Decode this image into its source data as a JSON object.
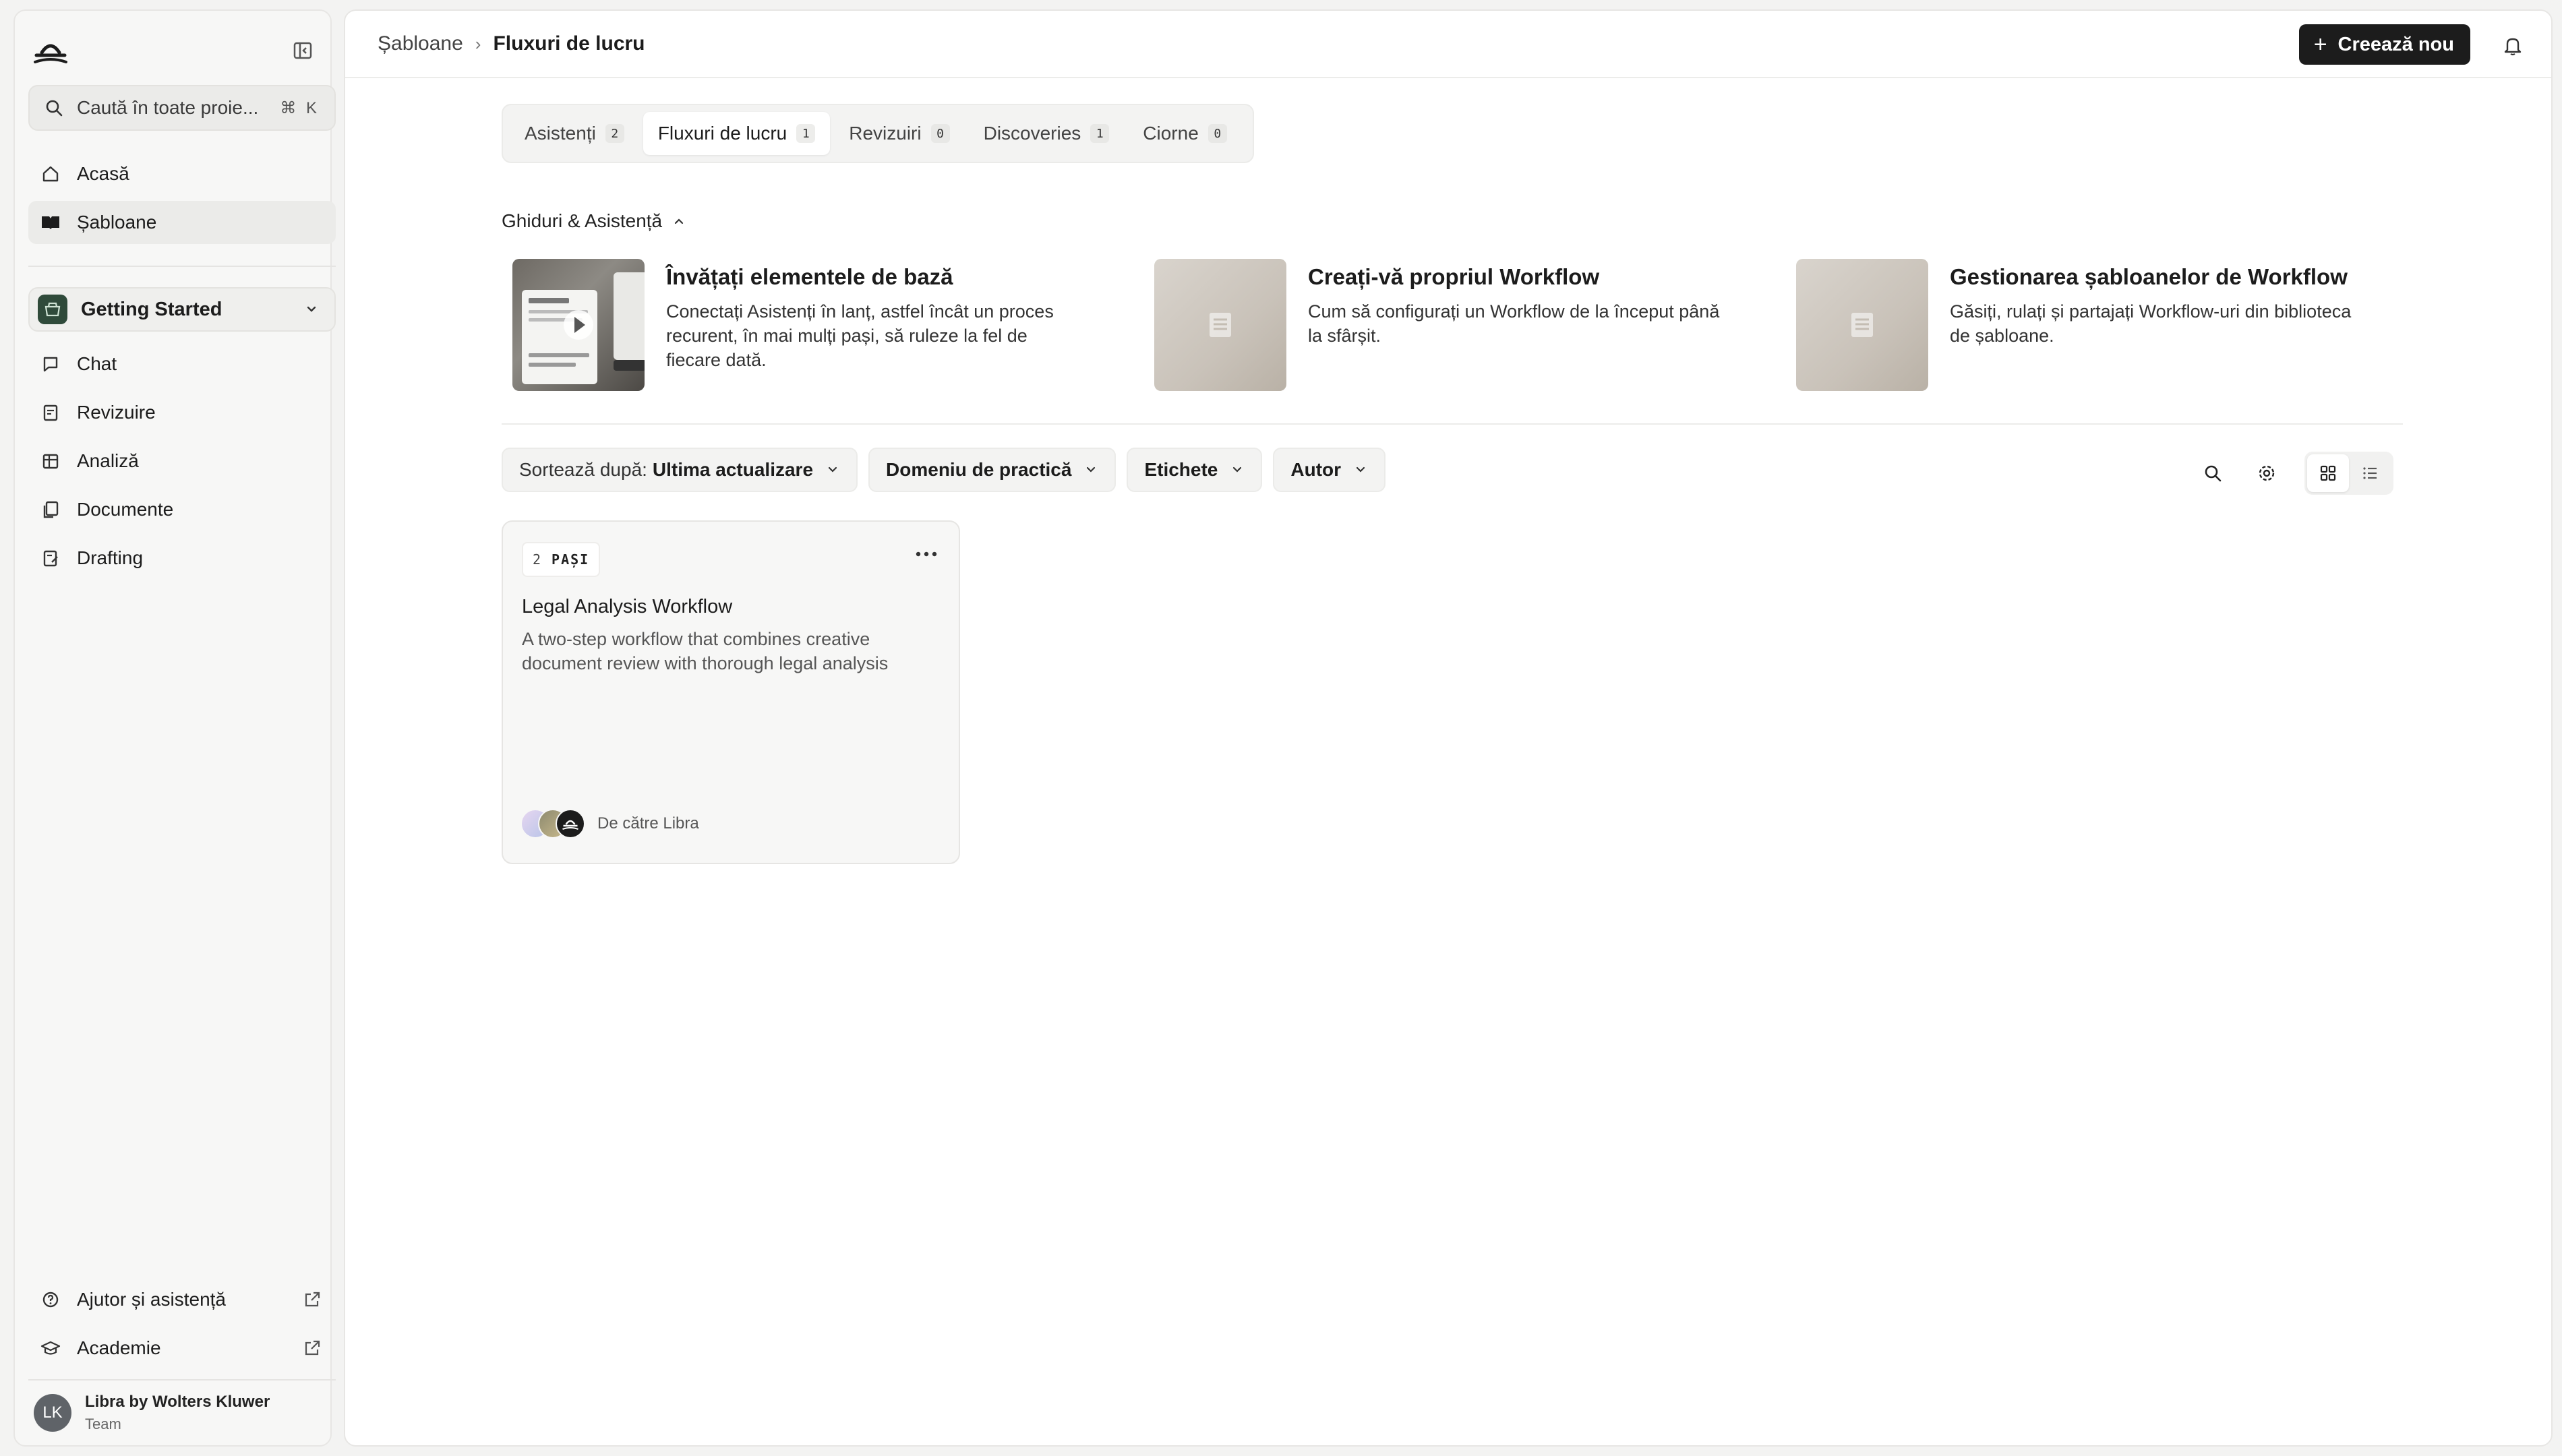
{
  "sidebar": {
    "search_placeholder": "Caută în toate proie...",
    "search_shortcut": "⌘ K",
    "nav_top": [
      {
        "label": "Acasă",
        "icon": "home-icon"
      },
      {
        "label": "Șabloane",
        "icon": "book-icon",
        "active": true
      }
    ],
    "project": {
      "label": "Getting Started",
      "icon": "folder-icon"
    },
    "nav_project": [
      {
        "label": "Chat",
        "icon": "chat-icon"
      },
      {
        "label": "Revizuire",
        "icon": "review-icon"
      },
      {
        "label": "Analiză",
        "icon": "table-icon"
      },
      {
        "label": "Documente",
        "icon": "documents-icon"
      },
      {
        "label": "Drafting",
        "icon": "drafting-icon"
      }
    ],
    "footer_links": [
      {
        "label": "Ajutor și asistență",
        "icon": "help-icon"
      },
      {
        "label": "Academie",
        "icon": "graduation-cap-icon"
      }
    ],
    "user": {
      "initials": "LK",
      "name": "Libra by Wolters Kluwer",
      "role": "Team"
    }
  },
  "header": {
    "breadcrumb": [
      "Șabloane",
      "Fluxuri de lucru"
    ],
    "create_label": "Creează nou"
  },
  "tabs": [
    {
      "label": "Asistenți",
      "count": "2"
    },
    {
      "label": "Fluxuri de lucru",
      "count": "1",
      "active": true
    },
    {
      "label": "Revizuiri",
      "count": "0"
    },
    {
      "label": "Discoveries",
      "count": "1"
    },
    {
      "label": "Ciorne",
      "count": "0"
    }
  ],
  "guides": {
    "heading": "Ghiduri & Asistență",
    "items": [
      {
        "title": "Învățați elementele de bază",
        "desc": "Conectați Asistenți în lanț, astfel încât un proces recurent, în mai mulți pași, să ruleze la fel de fiecare dată."
      },
      {
        "title": "Creați-vă propriul Workflow",
        "desc": "Cum să configurați un Workflow de la început până la sfârșit."
      },
      {
        "title": "Gestionarea șabloanelor de Workflow",
        "desc": "Găsiți, rulați și partajați Workflow-uri din biblioteca de șabloane."
      }
    ]
  },
  "filters": {
    "sort_prefix": "Sortează după:",
    "sort_value": "Ultima actualizare",
    "practice": "Domeniu de practică",
    "tags": "Etichete",
    "author": "Autor"
  },
  "card": {
    "steps_count": "2",
    "steps_word": "PAȘI",
    "title": "Legal Analysis Workflow",
    "desc": "A two-step workflow that combines creative document review with thorough legal analysis",
    "author": "De către Libra"
  }
}
